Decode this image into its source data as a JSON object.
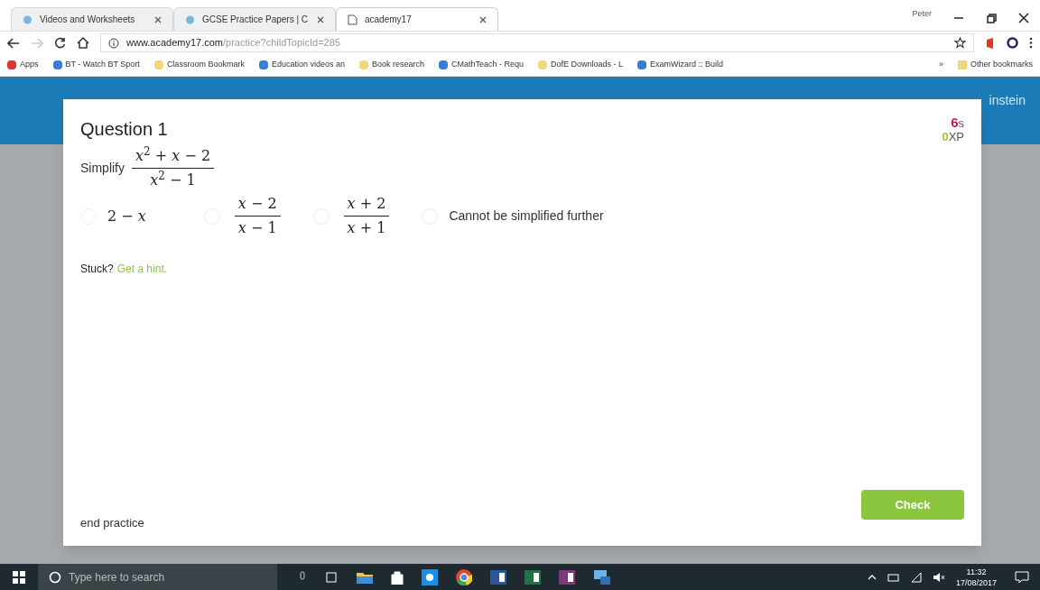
{
  "browser": {
    "tabs": [
      {
        "title": "Videos and Worksheets",
        "selected": false
      },
      {
        "title": "GCSE Practice Papers | C",
        "selected": false
      },
      {
        "title": "academy17",
        "selected": true
      }
    ],
    "profile": "Peter",
    "url": {
      "host": "www.academy17.com",
      "path": "/practice?childTopicId=285"
    },
    "bookmarks": [
      "Apps",
      "BT - Watch BT Sport",
      "Classroom Bookmark",
      "Education videos an",
      "Book research",
      "CMathTeach - Requ",
      "DofE Downloads - L",
      "ExamWizard :: Build"
    ],
    "more_bookmarks": "»",
    "other_bookmarks": "Other bookmarks"
  },
  "site_header": {
    "user": "instein"
  },
  "question": {
    "title": "Question 1",
    "timer": {
      "value": "6",
      "unit": "s"
    },
    "xp": {
      "value": "0",
      "unit": "XP"
    },
    "prompt": "Simplify",
    "expression": {
      "numerator": "*x*$^{2}$ + *x* − 2",
      "denominator": "*x*$^{2}$ − 1"
    },
    "options": [
      {
        "kind": "math",
        "text": "2 − *x*",
        "selected": false
      },
      {
        "kind": "fraction",
        "numerator": "*x* − 2",
        "denominator": "*x* − 1",
        "selected": false
      },
      {
        "kind": "fraction",
        "numerator": "*x* + 2",
        "denominator": "*x* + 1",
        "selected": false
      },
      {
        "kind": "text",
        "text": "Cannot be simplified further",
        "selected": false
      }
    ],
    "hint_prompt": "Stuck?",
    "hint_link": "Get a hint.",
    "end_link": "end practice",
    "check_button": "Check"
  },
  "taskbar": {
    "search_placeholder": "Type here to search",
    "time": "11:32",
    "date": "17/08/2017"
  }
}
